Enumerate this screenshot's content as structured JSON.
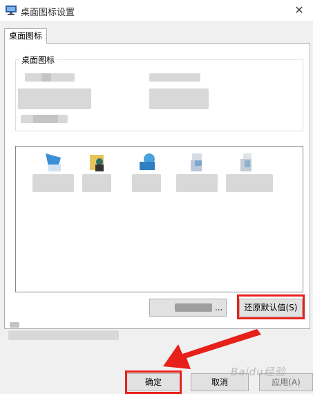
{
  "window": {
    "title": "桌面图标设置",
    "close_glyph": "✕"
  },
  "tab": {
    "label": "桌面图标"
  },
  "group": {
    "legend": "桌面图标"
  },
  "buttons": {
    "change_icon_suffix": "...",
    "restore_default": "还原默认值(S)",
    "ok": "确定",
    "cancel": "取消",
    "apply": "应用(A)"
  },
  "watermark": "Baidu经验",
  "colors": {
    "highlight_red": "#e8201a",
    "dialog_bg": "#f0f0f0",
    "button_bg": "#e1e1e1"
  },
  "icons": [
    "monitor-icon",
    "user-folder-icon",
    "network-icon",
    "recycle-bin-full-icon",
    "recycle-bin-empty-icon"
  ]
}
